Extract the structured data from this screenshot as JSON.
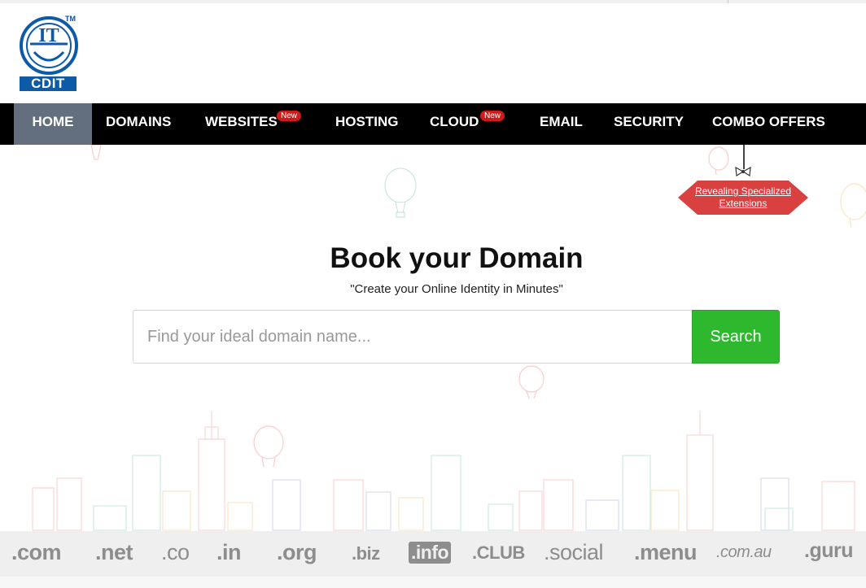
{
  "logo": {
    "text": "CDIT",
    "trademark": "TM",
    "monogram": "IT",
    "icon": "cdit-logo-icon"
  },
  "nav": {
    "items": [
      {
        "label": "HOME",
        "active": true
      },
      {
        "label": "DOMAINS",
        "active": false
      },
      {
        "label": "WEBSITES",
        "active": false,
        "badge": "New"
      },
      {
        "label": "HOSTING",
        "active": false
      },
      {
        "label": "CLOUD",
        "active": false,
        "badge": "New"
      },
      {
        "label": "EMAIL",
        "active": false
      },
      {
        "label": "SECURITY",
        "active": false
      },
      {
        "label": "COMBO OFFERS",
        "active": false
      }
    ]
  },
  "promo": {
    "line1": "Revealing Specialized",
    "line2": "Extensions"
  },
  "hero": {
    "title": "Book your Domain",
    "subtitle": "\"Create your Online Identity in Minutes\"",
    "search_placeholder": "Find your ideal domain name...",
    "search_button": "Search"
  },
  "tlds": [
    ".com",
    ".net",
    ".co",
    ".in",
    ".org",
    ".biz",
    ".info",
    ".CLUB",
    ".social",
    ".menu",
    ".com.au",
    ".guru"
  ],
  "colors": {
    "nav_bg": "#000000",
    "nav_active": "#636e7e",
    "badge_red": "#cf1a1a",
    "search_green": "#2eb82e",
    "logo_blue": "#0d5aa7",
    "promo_red": "#d94040"
  }
}
